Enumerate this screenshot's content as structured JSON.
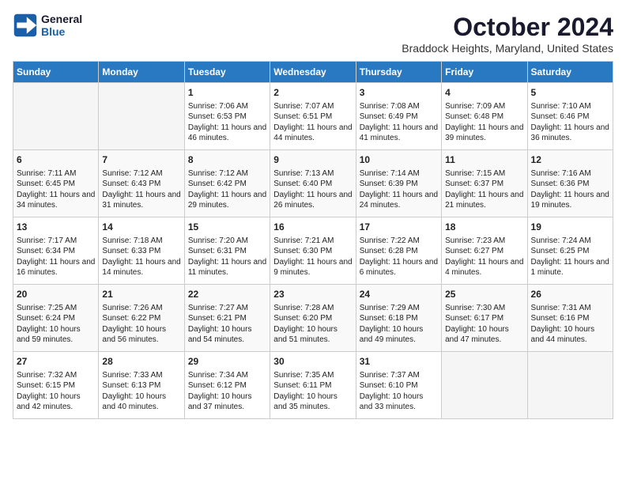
{
  "logo": {
    "line1": "General",
    "line2": "Blue"
  },
  "title": "October 2024",
  "location": "Braddock Heights, Maryland, United States",
  "days_header": [
    "Sunday",
    "Monday",
    "Tuesday",
    "Wednesday",
    "Thursday",
    "Friday",
    "Saturday"
  ],
  "weeks": [
    [
      {
        "day": "",
        "content": ""
      },
      {
        "day": "",
        "content": ""
      },
      {
        "day": "1",
        "content": "Sunrise: 7:06 AM\nSunset: 6:53 PM\nDaylight: 11 hours and 46 minutes."
      },
      {
        "day": "2",
        "content": "Sunrise: 7:07 AM\nSunset: 6:51 PM\nDaylight: 11 hours and 44 minutes."
      },
      {
        "day": "3",
        "content": "Sunrise: 7:08 AM\nSunset: 6:49 PM\nDaylight: 11 hours and 41 minutes."
      },
      {
        "day": "4",
        "content": "Sunrise: 7:09 AM\nSunset: 6:48 PM\nDaylight: 11 hours and 39 minutes."
      },
      {
        "day": "5",
        "content": "Sunrise: 7:10 AM\nSunset: 6:46 PM\nDaylight: 11 hours and 36 minutes."
      }
    ],
    [
      {
        "day": "6",
        "content": "Sunrise: 7:11 AM\nSunset: 6:45 PM\nDaylight: 11 hours and 34 minutes."
      },
      {
        "day": "7",
        "content": "Sunrise: 7:12 AM\nSunset: 6:43 PM\nDaylight: 11 hours and 31 minutes."
      },
      {
        "day": "8",
        "content": "Sunrise: 7:12 AM\nSunset: 6:42 PM\nDaylight: 11 hours and 29 minutes."
      },
      {
        "day": "9",
        "content": "Sunrise: 7:13 AM\nSunset: 6:40 PM\nDaylight: 11 hours and 26 minutes."
      },
      {
        "day": "10",
        "content": "Sunrise: 7:14 AM\nSunset: 6:39 PM\nDaylight: 11 hours and 24 minutes."
      },
      {
        "day": "11",
        "content": "Sunrise: 7:15 AM\nSunset: 6:37 PM\nDaylight: 11 hours and 21 minutes."
      },
      {
        "day": "12",
        "content": "Sunrise: 7:16 AM\nSunset: 6:36 PM\nDaylight: 11 hours and 19 minutes."
      }
    ],
    [
      {
        "day": "13",
        "content": "Sunrise: 7:17 AM\nSunset: 6:34 PM\nDaylight: 11 hours and 16 minutes."
      },
      {
        "day": "14",
        "content": "Sunrise: 7:18 AM\nSunset: 6:33 PM\nDaylight: 11 hours and 14 minutes."
      },
      {
        "day": "15",
        "content": "Sunrise: 7:20 AM\nSunset: 6:31 PM\nDaylight: 11 hours and 11 minutes."
      },
      {
        "day": "16",
        "content": "Sunrise: 7:21 AM\nSunset: 6:30 PM\nDaylight: 11 hours and 9 minutes."
      },
      {
        "day": "17",
        "content": "Sunrise: 7:22 AM\nSunset: 6:28 PM\nDaylight: 11 hours and 6 minutes."
      },
      {
        "day": "18",
        "content": "Sunrise: 7:23 AM\nSunset: 6:27 PM\nDaylight: 11 hours and 4 minutes."
      },
      {
        "day": "19",
        "content": "Sunrise: 7:24 AM\nSunset: 6:25 PM\nDaylight: 11 hours and 1 minute."
      }
    ],
    [
      {
        "day": "20",
        "content": "Sunrise: 7:25 AM\nSunset: 6:24 PM\nDaylight: 10 hours and 59 minutes."
      },
      {
        "day": "21",
        "content": "Sunrise: 7:26 AM\nSunset: 6:22 PM\nDaylight: 10 hours and 56 minutes."
      },
      {
        "day": "22",
        "content": "Sunrise: 7:27 AM\nSunset: 6:21 PM\nDaylight: 10 hours and 54 minutes."
      },
      {
        "day": "23",
        "content": "Sunrise: 7:28 AM\nSunset: 6:20 PM\nDaylight: 10 hours and 51 minutes."
      },
      {
        "day": "24",
        "content": "Sunrise: 7:29 AM\nSunset: 6:18 PM\nDaylight: 10 hours and 49 minutes."
      },
      {
        "day": "25",
        "content": "Sunrise: 7:30 AM\nSunset: 6:17 PM\nDaylight: 10 hours and 47 minutes."
      },
      {
        "day": "26",
        "content": "Sunrise: 7:31 AM\nSunset: 6:16 PM\nDaylight: 10 hours and 44 minutes."
      }
    ],
    [
      {
        "day": "27",
        "content": "Sunrise: 7:32 AM\nSunset: 6:15 PM\nDaylight: 10 hours and 42 minutes."
      },
      {
        "day": "28",
        "content": "Sunrise: 7:33 AM\nSunset: 6:13 PM\nDaylight: 10 hours and 40 minutes."
      },
      {
        "day": "29",
        "content": "Sunrise: 7:34 AM\nSunset: 6:12 PM\nDaylight: 10 hours and 37 minutes."
      },
      {
        "day": "30",
        "content": "Sunrise: 7:35 AM\nSunset: 6:11 PM\nDaylight: 10 hours and 35 minutes."
      },
      {
        "day": "31",
        "content": "Sunrise: 7:37 AM\nSunset: 6:10 PM\nDaylight: 10 hours and 33 minutes."
      },
      {
        "day": "",
        "content": ""
      },
      {
        "day": "",
        "content": ""
      }
    ]
  ]
}
